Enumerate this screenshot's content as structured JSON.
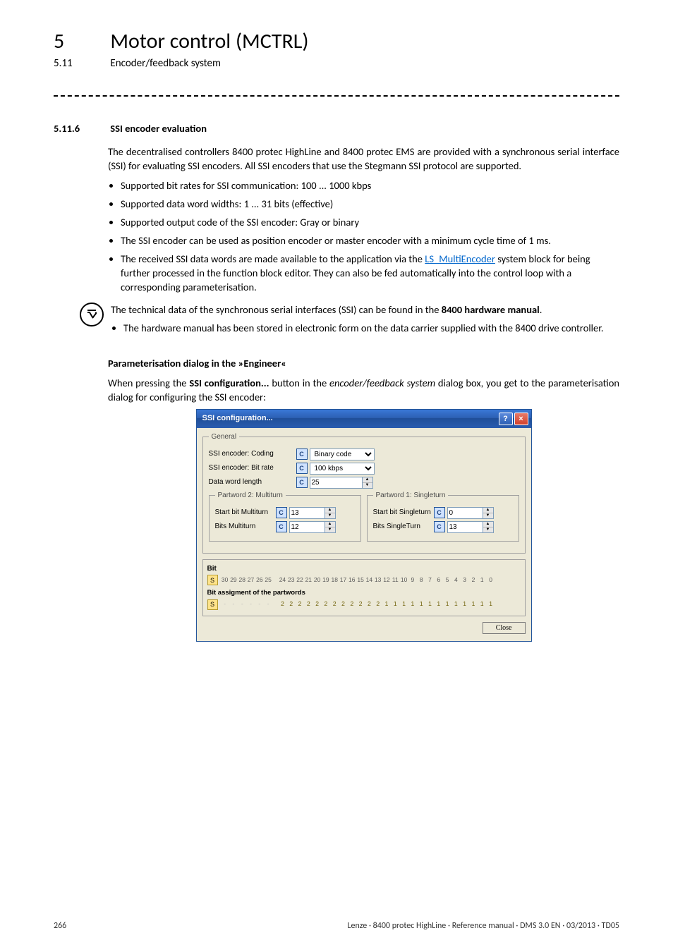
{
  "chapter": {
    "num": "5",
    "title": "Motor control (MCTRL)"
  },
  "section": {
    "num": "5.11",
    "title": "Encoder/feedback system"
  },
  "subsection": {
    "num": "5.11.6",
    "title": "SSI encoder evaluation"
  },
  "intro": "The decentralised controllers 8400 protec HighLine and 8400 protec EMS are provided with a synchronous serial interface (SSI) for evaluating SSI encoders. All SSI encoders that use the Stegmann SSI protocol are supported.",
  "bullets": [
    "Supported bit rates for SSI communication: 100 ... 1000 kbps",
    "Supported data word widths: 1 ... 31 bits (effective)",
    "Supported output code of the SSI encoder: Gray or binary",
    "The SSI encoder can be used as position encoder or master encoder with a minimum cycle time of 1 ms."
  ],
  "bullet_link": {
    "pre": "The received SSI data words are made available to the application via the ",
    "link": "LS_MultiEncoder",
    "post": " system block for being further processed in the function block editor. They can also be fed automatically into the control loop with a corresponding parameterisation."
  },
  "note": {
    "line1_pre": "The technical data of the synchronous serial interfaces (SSI) can be found in the ",
    "bold": "8400 hardware manual",
    "line1_post": ".",
    "sub": "The hardware manual has been stored in electronic form on the data carrier supplied with the 8400 drive controller."
  },
  "param_head": "Parameterisation dialog in the »Engineer«",
  "param_body_pre": "When pressing the ",
  "param_body_bold": "SSI configuration...",
  "param_body_mid": " button in the ",
  "param_body_ital": "encoder/feedback system",
  "param_body_post": " dialog box, you get to the parameterisation dialog for configuring the SSI encoder:",
  "dialog": {
    "title": "SSI configuration...",
    "help": "?",
    "close_x": "×",
    "general_legend": "General",
    "rows": {
      "coding": {
        "label": "SSI encoder: Coding",
        "value": "Binary code"
      },
      "bitrate": {
        "label": "SSI encoder: Bit rate",
        "value": "100 kbps"
      },
      "dword": {
        "label": "Data word length",
        "value": "25"
      }
    },
    "cmark": "C",
    "pw2": {
      "legend": "Partword 2: Multiturn",
      "startlbl": "Start bit Multiturn",
      "start": "13",
      "bitslbl": "Bits Multiturn",
      "bits": "12"
    },
    "pw1": {
      "legend": "Partword 1: Singleturn",
      "startlbl": "Start bit Singleturn",
      "start": "0",
      "bitslbl": "Bits SingleTurn",
      "bits": "13"
    },
    "bit": {
      "title": "Bit",
      "s": "S",
      "nums1": [
        "30",
        "29",
        "28",
        "27",
        "26",
        "25"
      ],
      "nums2": [
        "24",
        "23",
        "22",
        "21",
        "20",
        "19",
        "18",
        "17",
        "16",
        "15",
        "14",
        "13",
        "12",
        "11",
        "10",
        "9",
        "8",
        "7",
        "6",
        "5",
        "4",
        "3",
        "2",
        "1",
        "0"
      ],
      "assign_label": "Bit assigment of the partwords",
      "dashes": [
        "-",
        "-",
        "-",
        "-",
        "-",
        "-"
      ],
      "vals": [
        "2",
        "2",
        "2",
        "2",
        "2",
        "2",
        "2",
        "2",
        "2",
        "2",
        "2",
        "2",
        "1",
        "1",
        "1",
        "1",
        "1",
        "1",
        "1",
        "1",
        "1",
        "1",
        "1",
        "1",
        "1"
      ]
    },
    "close_btn": "Close"
  },
  "footer": {
    "pageno": "266",
    "right": "Lenze · 8400 protec HighLine · Reference manual · DMS 3.0 EN · 03/2013 · TD05"
  }
}
